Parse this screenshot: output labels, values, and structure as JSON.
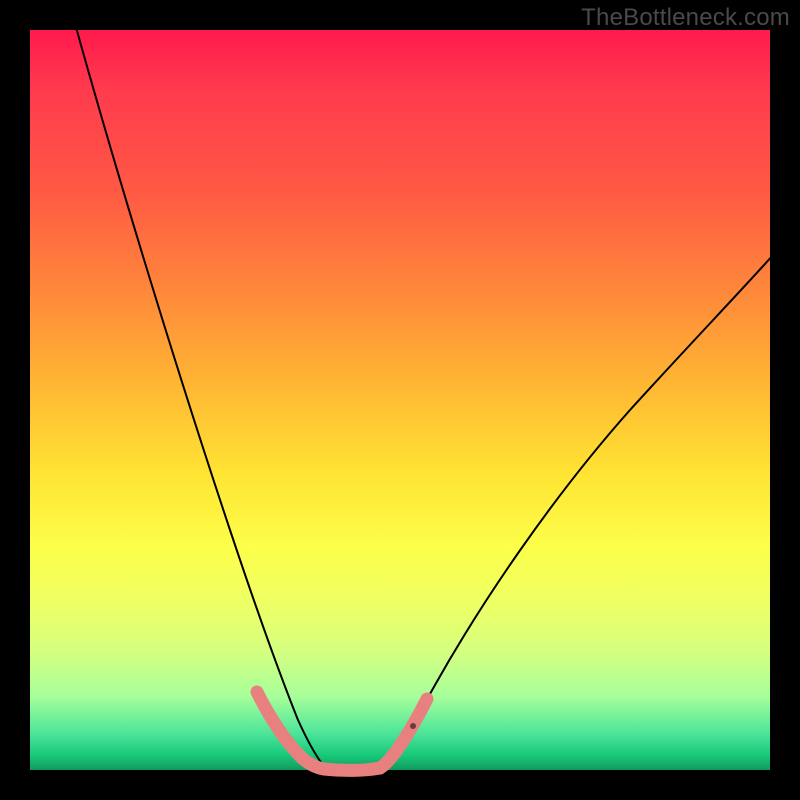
{
  "watermark": "TheBottleneck.com",
  "colors": {
    "background": "#000000",
    "curve": "#000000",
    "marker": "#e98080",
    "gradient_top": "#ff1a4d",
    "gradient_bottom": "#119a5e"
  },
  "chart_data": {
    "type": "line",
    "title": "",
    "xlabel": "",
    "ylabel": "",
    "xlim": [
      0,
      100
    ],
    "ylim": [
      0,
      100
    ],
    "grid": false,
    "legend": null,
    "note": "Unlabeled bottleneck V-curve; percentages estimated from pixel position within the plot area.",
    "series": [
      {
        "name": "left-branch",
        "x": [
          6,
          10,
          14,
          18,
          22,
          26,
          28,
          30,
          31.5,
          33,
          35,
          37,
          39
        ],
        "y": [
          100,
          80,
          62,
          46,
          33,
          20,
          14,
          9,
          6,
          4,
          2,
          1,
          0
        ]
      },
      {
        "name": "floor",
        "x": [
          39,
          47
        ],
        "y": [
          0,
          0
        ]
      },
      {
        "name": "right-branch",
        "x": [
          47,
          49,
          52,
          56,
          60,
          66,
          74,
          82,
          90,
          100
        ],
        "y": [
          0,
          3,
          8,
          16,
          24,
          34,
          46,
          56,
          64,
          72
        ]
      }
    ],
    "markers": [
      {
        "name": "left-cluster",
        "type": "thick-segment",
        "x": [
          30,
          38
        ],
        "y": [
          9,
          0.5
        ]
      },
      {
        "name": "floor-cluster",
        "type": "thick-segment",
        "x": [
          38,
          47
        ],
        "y": [
          0,
          0
        ]
      },
      {
        "name": "right-cluster",
        "type": "thick-segment",
        "x": [
          47,
          52
        ],
        "y": [
          0.5,
          9
        ]
      },
      {
        "name": "tiny-dot",
        "type": "dot",
        "x": 51,
        "y": 6
      }
    ]
  }
}
